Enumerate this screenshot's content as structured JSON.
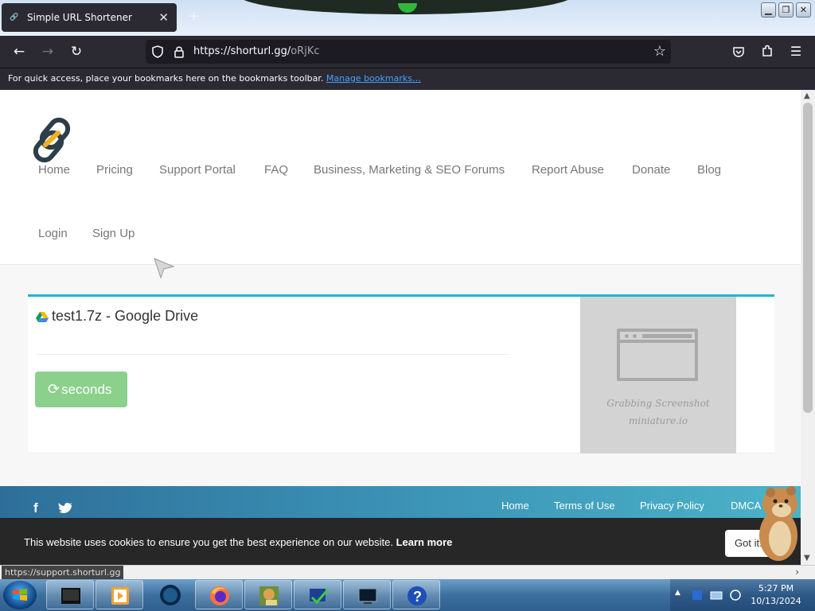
{
  "browser": {
    "tab_title": "Simple URL Shortener",
    "tab_close": "✕",
    "new_tab": "+",
    "url_host": "https://shorturl.gg/",
    "url_path": "oRjKc",
    "bookmarks_message": "For quick access, place your bookmarks here on the bookmarks toolbar.",
    "manage_bookmarks": "Manage bookmarks…"
  },
  "site": {
    "nav": [
      "Home",
      "Pricing",
      "Support Portal",
      "FAQ",
      "Business, Marketing & SEO Forums",
      "Report Abuse",
      "Donate",
      "Blog",
      "Login",
      "Sign Up"
    ],
    "file_title": "test1.7z - Google Drive",
    "seconds_label": "seconds",
    "screenshot_caption_1": "Grabbing Screenshot",
    "screenshot_caption_2": "miniature.io",
    "footer_links": [
      "Home",
      "Terms of Use",
      "Privacy Policy",
      "DMCA"
    ],
    "social": [
      "f",
      "t"
    ],
    "cookie_message": "This website uses cookies to ensure you get the best experience on our website.",
    "cookie_learn_more": "Learn more",
    "cookie_button": "Got it!"
  },
  "status_bar": {
    "hover_url": "https://support.shorturl.gg"
  },
  "taskbar": {
    "time": "5:27 PM",
    "date": "10/13/2024"
  },
  "colors": {
    "accent": "#1fb5d6",
    "button_green": "#8bd08b",
    "chrome_dark": "#2b2a33"
  }
}
